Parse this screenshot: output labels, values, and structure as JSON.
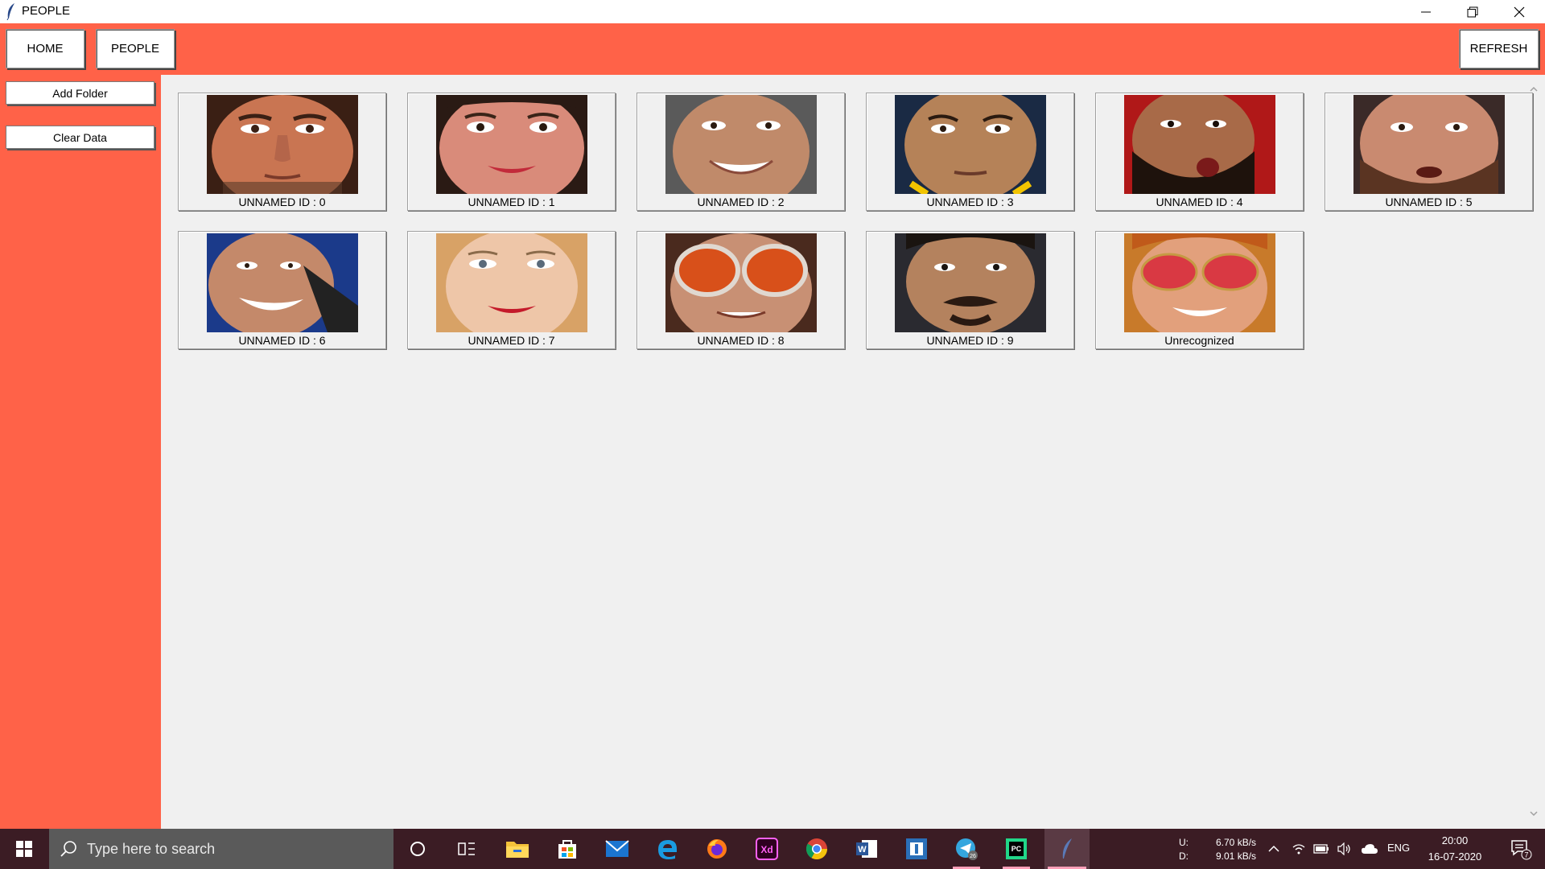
{
  "window": {
    "title": "PEOPLE"
  },
  "nav": {
    "home_label": "HOME",
    "people_label": "PEOPLE",
    "refresh_label": "REFRESH"
  },
  "sidebar": {
    "add_folder_label": "Add Folder",
    "clear_data_label": "Clear Data"
  },
  "people": [
    {
      "caption": "UNNAMED ID : 0"
    },
    {
      "caption": "UNNAMED ID : 1"
    },
    {
      "caption": "UNNAMED ID : 2"
    },
    {
      "caption": "UNNAMED ID : 3"
    },
    {
      "caption": "UNNAMED ID : 4"
    },
    {
      "caption": "UNNAMED ID : 5"
    },
    {
      "caption": "UNNAMED ID : 6"
    },
    {
      "caption": "UNNAMED ID : 7"
    },
    {
      "caption": "UNNAMED ID : 8"
    },
    {
      "caption": "UNNAMED ID : 9"
    },
    {
      "caption": "Unrecognized"
    }
  ],
  "taskbar": {
    "search_placeholder": "Type here to search",
    "net_up_label": "U:",
    "net_down_label": "D:",
    "net_up": "6.70 kB/s",
    "net_down": "9.01 kB/s",
    "language": "ENG",
    "time": "20:00",
    "date": "16-07-2020",
    "notification_count": "7",
    "telegram_badge": "26"
  },
  "colors": {
    "accent": "#ff6248",
    "taskbar": "#3b1c24",
    "content_bg": "#f0f0f0"
  },
  "icons": [
    "feather-icon",
    "minimize-icon",
    "maximize-icon",
    "close-icon",
    "windows-start-icon",
    "search-icon",
    "cortana-icon",
    "task-view-icon",
    "file-explorer-icon",
    "store-icon",
    "mail-icon",
    "edge-icon",
    "firefox-icon",
    "xd-icon",
    "chrome-icon",
    "word-icon",
    "app-icon",
    "telegram-icon",
    "pycharm-icon",
    "feather-app-icon",
    "chevron-up-icon",
    "wifi-icon",
    "battery-icon",
    "volume-icon",
    "cloud-icon",
    "notification-icon"
  ]
}
